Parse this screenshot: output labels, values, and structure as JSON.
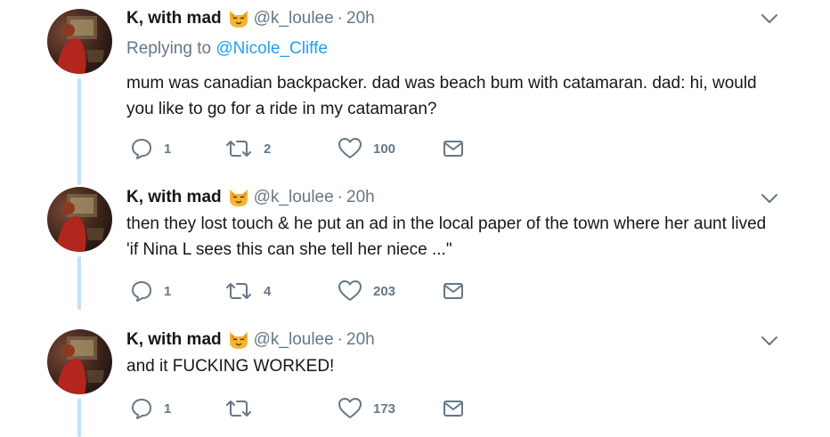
{
  "tweets": [
    {
      "name": "K, with mad",
      "handle": "@k_loulee",
      "separator": "·",
      "time": "20h",
      "replying_prefix": "Replying to",
      "replying_to": "@Nicole_Cliffe",
      "text": "mum was canadian backpacker. dad was beach bum with catamaran. dad: hi, would you like to go for a ride in my catamaran?",
      "replies": "1",
      "retweets": "2",
      "likes": "100"
    },
    {
      "name": "K, with mad",
      "handle": "@k_loulee",
      "separator": "·",
      "time": "20h",
      "text": "then they lost touch & he put an ad in the local paper of the town where her aunt lived 'if Nina L sees this can she tell her niece ...\"",
      "replies": "1",
      "retweets": "4",
      "likes": "203"
    },
    {
      "name": "K, with mad",
      "handle": "@k_loulee",
      "separator": "·",
      "time": "20h",
      "text": "and it FUCKING WORKED!",
      "replies": "1",
      "retweets": "",
      "likes": "173"
    }
  ],
  "icons": {
    "emoji": "cat-face-emoji",
    "reply": "reply-icon",
    "retweet": "retweet-icon",
    "like": "heart-icon",
    "dm": "envelope-icon",
    "caret": "chevron-down-icon"
  },
  "colors": {
    "text": "#14171a",
    "muted": "#657786",
    "link": "#1da1f2",
    "thread_line": "#bfe2f9"
  }
}
